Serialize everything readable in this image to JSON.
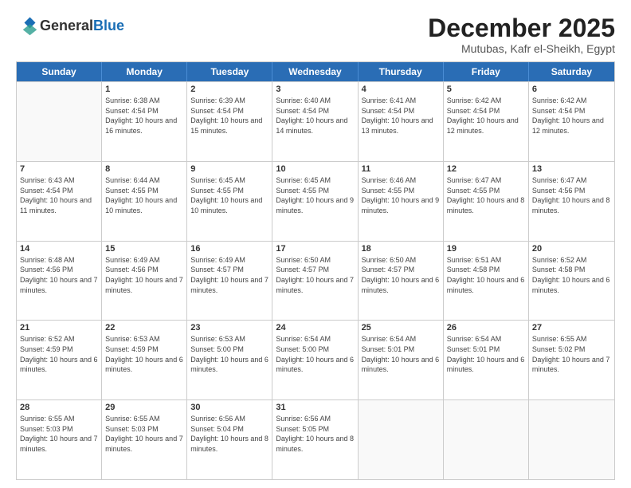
{
  "logo": {
    "general": "General",
    "blue": "Blue"
  },
  "header": {
    "month": "December 2025",
    "location": "Mutubas, Kafr el-Sheikh, Egypt"
  },
  "days_of_week": [
    "Sunday",
    "Monday",
    "Tuesday",
    "Wednesday",
    "Thursday",
    "Friday",
    "Saturday"
  ],
  "weeks": [
    [
      {
        "day": "",
        "empty": true
      },
      {
        "day": "1",
        "sunrise": "6:38 AM",
        "sunset": "4:54 PM",
        "daylight": "10 hours and 16 minutes."
      },
      {
        "day": "2",
        "sunrise": "6:39 AM",
        "sunset": "4:54 PM",
        "daylight": "10 hours and 15 minutes."
      },
      {
        "day": "3",
        "sunrise": "6:40 AM",
        "sunset": "4:54 PM",
        "daylight": "10 hours and 14 minutes."
      },
      {
        "day": "4",
        "sunrise": "6:41 AM",
        "sunset": "4:54 PM",
        "daylight": "10 hours and 13 minutes."
      },
      {
        "day": "5",
        "sunrise": "6:42 AM",
        "sunset": "4:54 PM",
        "daylight": "10 hours and 12 minutes."
      },
      {
        "day": "6",
        "sunrise": "6:42 AM",
        "sunset": "4:54 PM",
        "daylight": "10 hours and 12 minutes."
      }
    ],
    [
      {
        "day": "7",
        "sunrise": "6:43 AM",
        "sunset": "4:54 PM",
        "daylight": "10 hours and 11 minutes."
      },
      {
        "day": "8",
        "sunrise": "6:44 AM",
        "sunset": "4:55 PM",
        "daylight": "10 hours and 10 minutes."
      },
      {
        "day": "9",
        "sunrise": "6:45 AM",
        "sunset": "4:55 PM",
        "daylight": "10 hours and 10 minutes."
      },
      {
        "day": "10",
        "sunrise": "6:45 AM",
        "sunset": "4:55 PM",
        "daylight": "10 hours and 9 minutes."
      },
      {
        "day": "11",
        "sunrise": "6:46 AM",
        "sunset": "4:55 PM",
        "daylight": "10 hours and 9 minutes."
      },
      {
        "day": "12",
        "sunrise": "6:47 AM",
        "sunset": "4:55 PM",
        "daylight": "10 hours and 8 minutes."
      },
      {
        "day": "13",
        "sunrise": "6:47 AM",
        "sunset": "4:56 PM",
        "daylight": "10 hours and 8 minutes."
      }
    ],
    [
      {
        "day": "14",
        "sunrise": "6:48 AM",
        "sunset": "4:56 PM",
        "daylight": "10 hours and 7 minutes."
      },
      {
        "day": "15",
        "sunrise": "6:49 AM",
        "sunset": "4:56 PM",
        "daylight": "10 hours and 7 minutes."
      },
      {
        "day": "16",
        "sunrise": "6:49 AM",
        "sunset": "4:57 PM",
        "daylight": "10 hours and 7 minutes."
      },
      {
        "day": "17",
        "sunrise": "6:50 AM",
        "sunset": "4:57 PM",
        "daylight": "10 hours and 7 minutes."
      },
      {
        "day": "18",
        "sunrise": "6:50 AM",
        "sunset": "4:57 PM",
        "daylight": "10 hours and 6 minutes."
      },
      {
        "day": "19",
        "sunrise": "6:51 AM",
        "sunset": "4:58 PM",
        "daylight": "10 hours and 6 minutes."
      },
      {
        "day": "20",
        "sunrise": "6:52 AM",
        "sunset": "4:58 PM",
        "daylight": "10 hours and 6 minutes."
      }
    ],
    [
      {
        "day": "21",
        "sunrise": "6:52 AM",
        "sunset": "4:59 PM",
        "daylight": "10 hours and 6 minutes."
      },
      {
        "day": "22",
        "sunrise": "6:53 AM",
        "sunset": "4:59 PM",
        "daylight": "10 hours and 6 minutes."
      },
      {
        "day": "23",
        "sunrise": "6:53 AM",
        "sunset": "5:00 PM",
        "daylight": "10 hours and 6 minutes."
      },
      {
        "day": "24",
        "sunrise": "6:54 AM",
        "sunset": "5:00 PM",
        "daylight": "10 hours and 6 minutes."
      },
      {
        "day": "25",
        "sunrise": "6:54 AM",
        "sunset": "5:01 PM",
        "daylight": "10 hours and 6 minutes."
      },
      {
        "day": "26",
        "sunrise": "6:54 AM",
        "sunset": "5:01 PM",
        "daylight": "10 hours and 6 minutes."
      },
      {
        "day": "27",
        "sunrise": "6:55 AM",
        "sunset": "5:02 PM",
        "daylight": "10 hours and 7 minutes."
      }
    ],
    [
      {
        "day": "28",
        "sunrise": "6:55 AM",
        "sunset": "5:03 PM",
        "daylight": "10 hours and 7 minutes."
      },
      {
        "day": "29",
        "sunrise": "6:55 AM",
        "sunset": "5:03 PM",
        "daylight": "10 hours and 7 minutes."
      },
      {
        "day": "30",
        "sunrise": "6:56 AM",
        "sunset": "5:04 PM",
        "daylight": "10 hours and 8 minutes."
      },
      {
        "day": "31",
        "sunrise": "6:56 AM",
        "sunset": "5:05 PM",
        "daylight": "10 hours and 8 minutes."
      },
      {
        "day": "",
        "empty": true
      },
      {
        "day": "",
        "empty": true
      },
      {
        "day": "",
        "empty": true
      }
    ]
  ],
  "labels": {
    "sunrise_prefix": "Sunrise: ",
    "sunset_prefix": "Sunset: ",
    "daylight_prefix": "Daylight: "
  }
}
